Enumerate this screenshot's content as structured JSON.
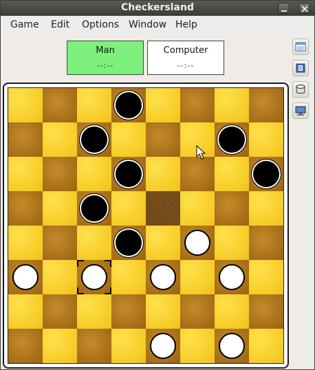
{
  "window": {
    "title": "Checkersland"
  },
  "menu": [
    "Game",
    "Edit",
    "Options",
    "Window",
    "Help"
  ],
  "players": [
    {
      "name": "Man",
      "time": "--:--",
      "active": true,
      "color": "#7df07d"
    },
    {
      "name": "Computer",
      "time": "--:--",
      "active": false,
      "color": "#ffffff"
    }
  ],
  "toolbar_icons": [
    "list-icon",
    "book-icon",
    "database-icon",
    "monitor-icon"
  ],
  "board": {
    "rows": 8,
    "cols": 8,
    "highlighted_square": [
      3,
      4
    ],
    "selected_square": [
      5,
      2
    ],
    "pieces": {
      "black": [
        [
          0,
          3
        ],
        [
          1,
          2
        ],
        [
          1,
          6
        ],
        [
          2,
          3
        ],
        [
          2,
          7
        ],
        [
          3,
          2
        ],
        [
          4,
          3
        ]
      ],
      "white": [
        [
          4,
          5
        ],
        [
          5,
          0
        ],
        [
          5,
          2
        ],
        [
          5,
          4
        ],
        [
          5,
          6
        ],
        [
          7,
          4
        ],
        [
          7,
          6
        ]
      ]
    }
  }
}
